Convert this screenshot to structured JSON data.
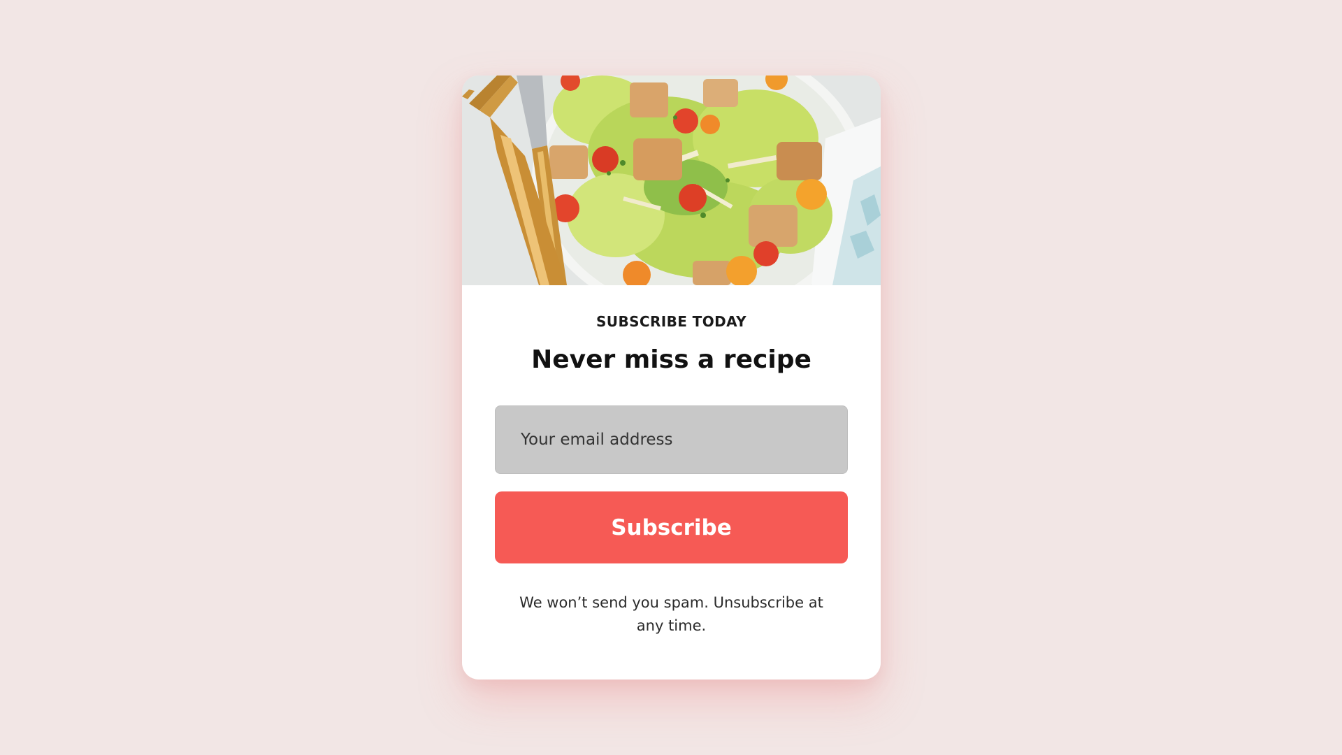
{
  "hero": {
    "image_alt": "Salad with croutons, parmesan and cherry tomatoes with gold cutlery"
  },
  "card": {
    "eyebrow": "SUBSCRIBE TODAY",
    "heading": "Never miss a recipe",
    "email_placeholder": "Your email address",
    "button_label": "Subscribe",
    "disclaimer": "We won’t send you spam. Unsubscribe at any time."
  },
  "colors": {
    "page_background": "#f2e6e5",
    "card_background": "#ffffff",
    "input_background": "#c8c8c8",
    "accent": "#f65a55",
    "button_text": "#ffffff",
    "heading_text": "#111111"
  }
}
